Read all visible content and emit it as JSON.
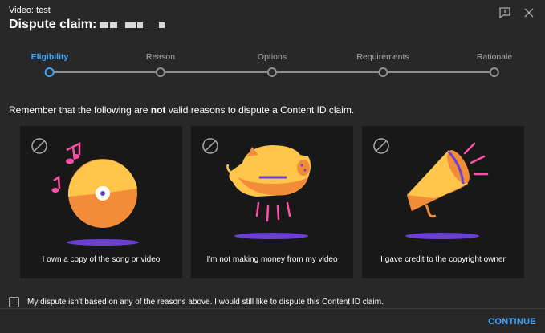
{
  "header": {
    "video_label": "Video: test",
    "title": "Dispute claim:"
  },
  "top_icons": [
    "feedback-icon",
    "close-icon"
  ],
  "stepper": {
    "steps": [
      {
        "label": "Eligibility",
        "active": true
      },
      {
        "label": "Reason",
        "active": false
      },
      {
        "label": "Options",
        "active": false
      },
      {
        "label": "Requirements",
        "active": false
      },
      {
        "label": "Rationale",
        "active": false
      }
    ]
  },
  "notice": {
    "prefix": "Remember that the following are ",
    "emphasis": "not",
    "suffix": " valid reasons to dispute a Content ID claim."
  },
  "cards": [
    {
      "caption": "I own a copy of the song or video",
      "icon": "music-disc-illustration"
    },
    {
      "caption": "I'm not making money from my video",
      "icon": "piggy-bank-illustration"
    },
    {
      "caption": "I gave credit to the copyright owner",
      "icon": "megaphone-illustration"
    }
  ],
  "checkbox": {
    "label": "My dispute isn't based on any of the reasons above. I would still like to dispute this Content ID claim.",
    "checked": false
  },
  "footer": {
    "continue_label": "CONTINUE"
  },
  "colors": {
    "background": "#282828",
    "card": "#181818",
    "accent": "#3ea6ff",
    "orange": "#f28c38",
    "yellow": "#ffc64b",
    "pink": "#ff4fa8",
    "purple": "#6b3fd4"
  }
}
